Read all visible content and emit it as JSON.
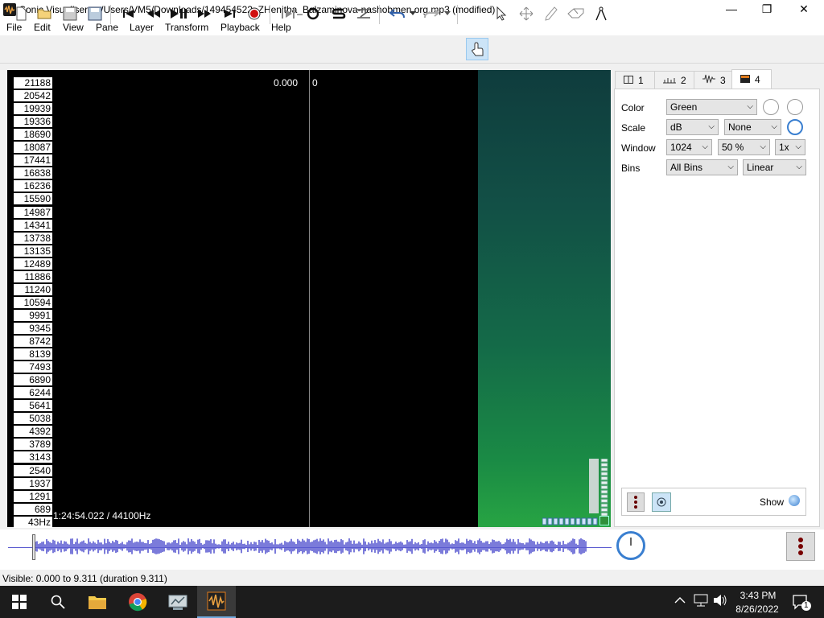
{
  "window": {
    "title": "Sonic Visualiser: c:/Users/VM5/Downloads/149454522_ZHenitba_Balzaminova-nashobmen.org.mp3 (modified)",
    "minimize": "—",
    "maximize": "❐",
    "close": "✕"
  },
  "menu": [
    "File",
    "Edit",
    "View",
    "Pane",
    "Layer",
    "Transform",
    "Playback",
    "Help"
  ],
  "toolbar": {
    "icons": [
      "new-file-icon",
      "open-icon",
      "save-icon",
      "save-as-icon",
      "rewind-start-icon",
      "rewind-icon",
      "play-pause-icon",
      "fast-forward-icon",
      "forward-end-icon",
      "record-icon",
      "play-selection-icon",
      "loop-icon",
      "solo-icon",
      "follow-playback-icon",
      "undo-icon",
      "redo-icon",
      "navigate-tool-icon",
      "select-tool-icon",
      "move-tool-icon",
      "draw-tool-icon",
      "erase-tool-icon",
      "measure-tool-icon"
    ]
  },
  "pane": {
    "scale_labels": [
      "21188",
      "20542",
      "19939",
      "19336",
      "18690",
      "18087",
      "17441",
      "16838",
      "16236",
      "15590",
      "14987",
      "14341",
      "13738",
      "13135",
      "12489",
      "11886",
      "11240",
      "10594",
      "9991",
      "9345",
      "8742",
      "8139",
      "7493",
      "6890",
      "6244",
      "5641",
      "5038",
      "4392",
      "3789",
      "3143",
      "2540",
      "1937",
      "1291",
      "689",
      "43Hz"
    ],
    "value_left": "0.000",
    "value_right": "0",
    "time_readout": "1:24:54.022 / 44100Hz"
  },
  "properties": {
    "tabs": [
      {
        "label": "1",
        "icon": "pane-icon"
      },
      {
        "label": "2",
        "icon": "time-ruler-icon"
      },
      {
        "label": "3",
        "icon": "waveform-icon"
      },
      {
        "label": "4",
        "icon": "spectrogram-icon"
      }
    ],
    "active_tab": "4",
    "color_label": "Color",
    "color_value": "Green",
    "scale_label": "Scale",
    "scale_value": "dB",
    "scale_mode": "None",
    "window_label": "Window",
    "window_size": "1024",
    "window_overlap": "50 %",
    "window_oversample": "1x",
    "bins_label": "Bins",
    "bins_value": "All Bins",
    "bins_scale": "Linear",
    "show_label": "Show"
  },
  "status": {
    "text": "Visible: 0.000 to 9.311 (duration 9.311)"
  },
  "taskbar": {
    "time": "3:43 PM",
    "date": "8/26/2022",
    "notification_count": "1"
  }
}
